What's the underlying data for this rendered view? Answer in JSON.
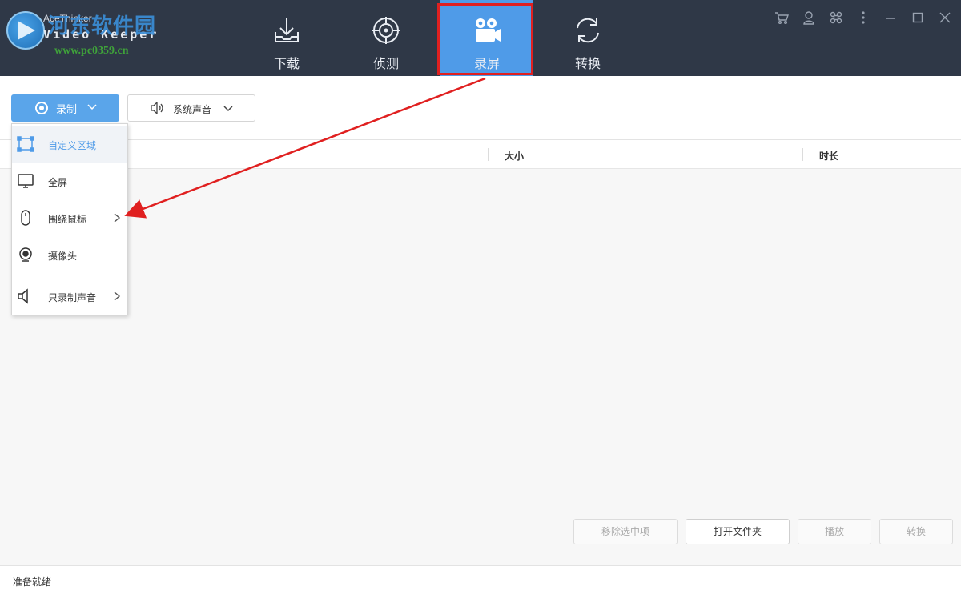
{
  "app": {
    "logo_line1": "AceThinker",
    "logo_line2": "Video Keeper",
    "watermark_name": "河东软件园",
    "watermark_url": "www.pc0359.cn"
  },
  "nav": {
    "tabs": [
      {
        "label": "下载",
        "icon": "download-icon",
        "active": false
      },
      {
        "label": "侦测",
        "icon": "detect-icon",
        "active": false
      },
      {
        "label": "录屏",
        "icon": "video-camera-icon",
        "active": true
      },
      {
        "label": "转换",
        "icon": "convert-icon",
        "active": false
      }
    ]
  },
  "window_icons": [
    "cart-icon",
    "user-icon",
    "command-icon",
    "more-icon",
    "minimize-icon",
    "maximize-icon",
    "close-icon"
  ],
  "toolbar": {
    "record_label": "录制",
    "sound_label": "系统声音"
  },
  "record_menu": {
    "items": [
      {
        "label": "自定义区域",
        "icon": "region-select-icon",
        "active": true,
        "submenu": false
      },
      {
        "label": "全屏",
        "icon": "monitor-icon",
        "active": false,
        "submenu": false
      },
      {
        "label": "围绕鼠标",
        "icon": "mouse-icon",
        "active": false,
        "submenu": true
      },
      {
        "label": "摄像头",
        "icon": "webcam-icon",
        "active": false,
        "submenu": false
      },
      {
        "label": "只录制声音",
        "icon": "speaker-icon",
        "active": false,
        "submenu": true
      }
    ]
  },
  "table": {
    "columns": [
      "大小",
      "时长"
    ]
  },
  "actions": {
    "remove": "移除选中项",
    "open_folder": "打开文件夹",
    "play": "播放",
    "convert": "转换"
  },
  "status": {
    "text": "准备就绪"
  },
  "colors": {
    "header_bg": "#2f3847",
    "accent": "#4f9be8",
    "highlight": "#e02020"
  }
}
